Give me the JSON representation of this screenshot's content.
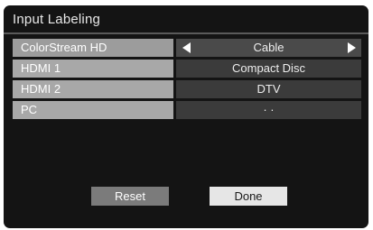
{
  "dialog": {
    "title": "Input Labeling"
  },
  "rows": [
    {
      "input": "ColorStream HD",
      "label": "Cable",
      "selected": true,
      "arrows": [
        "left-arrow-icon",
        "right-arrow-icon"
      ]
    },
    {
      "input": "HDMI 1",
      "label": "Compact Disc",
      "selected": false
    },
    {
      "input": "HDMI 2",
      "label": "DTV",
      "selected": false
    },
    {
      "input": "PC",
      "label": "· ·",
      "selected": false
    }
  ],
  "buttons": {
    "reset_label": "Reset",
    "done_label": "Done"
  },
  "colors": {
    "background": "#141414",
    "label_cell": "#a8a8a8",
    "value_cell": "#3b3b3b",
    "done_button": "#e6e6e6",
    "reset_button": "#7b7b7b"
  }
}
